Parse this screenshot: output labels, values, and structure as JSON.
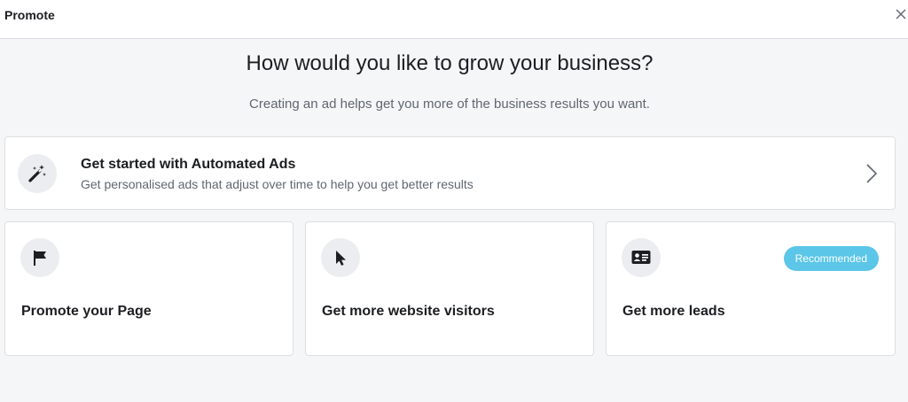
{
  "header": {
    "title": "Promote",
    "close_icon": "close-icon"
  },
  "main": {
    "heading": "How would you like to grow your business?",
    "subheading": "Creating an ad helps get you more of the business results you want."
  },
  "automated_ads": {
    "icon": "magic-wand-icon",
    "title": "Get started with Automated Ads",
    "description": "Get personalised ads that adjust over time to help you get better results",
    "chevron_icon": "chevron-right-icon"
  },
  "options": [
    {
      "icon": "flag-icon",
      "title": "Promote your Page"
    },
    {
      "icon": "cursor-icon",
      "title": "Get more website visitors"
    },
    {
      "icon": "contact-card-icon",
      "title": "Get more leads",
      "badge": "Recommended"
    }
  ],
  "colors": {
    "badge_background": "#5bc6e8",
    "page_background": "#f5f6f7",
    "icon_circle": "#ebedf0"
  }
}
